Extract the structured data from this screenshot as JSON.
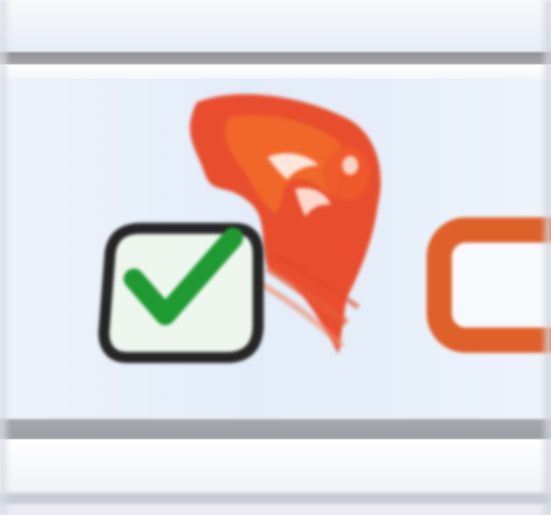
{
  "toolbar": {
    "button": {
      "icon": "flame-bird-app-icon",
      "overlay_icon": "checked-checkbox-icon",
      "checked": true
    },
    "next_item_icon": "orange-frame-icon"
  },
  "colors": {
    "app_icon_primary": "#e8401c",
    "app_icon_secondary": "#f26a2a",
    "check_mark": "#1f9a33",
    "checkbox_border": "#2a2a2a",
    "checkbox_fill": "#eef7ee",
    "side_widget_border": "#e0602a",
    "band_background": "#e4edf8"
  }
}
